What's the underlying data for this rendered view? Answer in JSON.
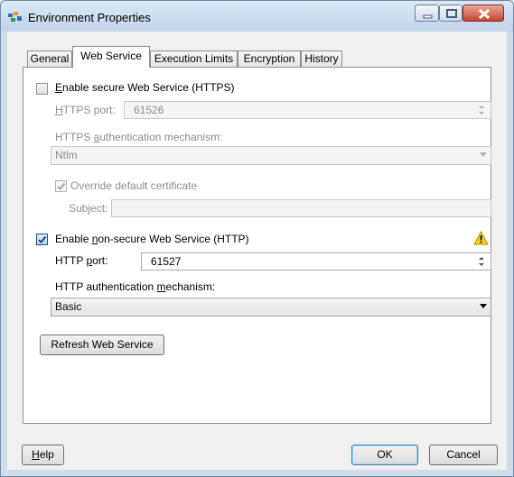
{
  "window": {
    "title": "Environment Properties",
    "icon": "environment-app-icon"
  },
  "tabs": [
    {
      "label": "General",
      "active": false
    },
    {
      "label": "Web Service",
      "active": true
    },
    {
      "label": "Execution Limits",
      "active": false
    },
    {
      "label": "Encryption",
      "active": false
    },
    {
      "label": "History",
      "active": false
    }
  ],
  "https": {
    "enable_label": "Enable secure Web Service (HTTPS)",
    "enable_access_key": "E",
    "enable_rest": "nable secure Web Service (HTTPS)",
    "enabled": false,
    "port_label_key": "H",
    "port_label_rest": "TTPS port:",
    "port_value": "61526",
    "auth_label_pre": "HTTPS ",
    "auth_label_key": "a",
    "auth_label_rest": "uthentication mechanism:",
    "auth_value": "Ntlm",
    "override_label": "Override default certificate",
    "override_checked": true,
    "subject_label": "Subject:",
    "subject_value": ""
  },
  "http": {
    "enable_pre": "Enable ",
    "enable_key": "n",
    "enable_rest": "on-secure Web Service (HTTP)",
    "enabled": true,
    "warning_icon": "warning-icon",
    "port_pre": "HTTP ",
    "port_key": "p",
    "port_rest": "ort:",
    "port_value": "61527",
    "auth_pre": "HTTP authentication ",
    "auth_key": "m",
    "auth_rest": "echanism:",
    "auth_value": "Basic"
  },
  "buttons": {
    "refresh": "Refresh Web Service",
    "help_key": "H",
    "help_rest": "elp",
    "ok": "OK",
    "cancel": "Cancel"
  }
}
